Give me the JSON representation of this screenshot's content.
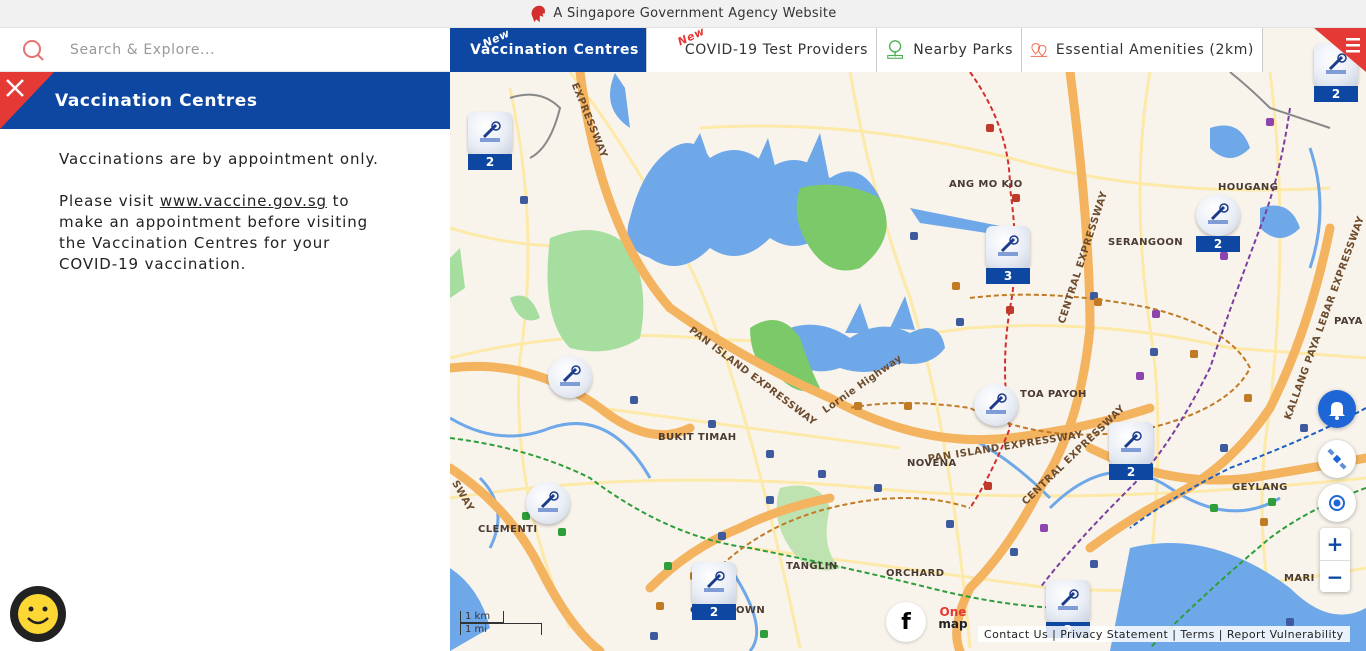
{
  "gov_bar": {
    "text": "A Singapore Government Agency Website"
  },
  "search": {
    "placeholder": "Search & Explore..."
  },
  "panel": {
    "title": "Vaccination Centres",
    "line1": "Vaccinations are by appointment only.",
    "para2_prefix": "Please visit ",
    "para2_link": "www.vaccine.gov.sg",
    "para2_suffix": " to make an appointment before visiting the Vaccination Centres for your COVID-19 vaccination."
  },
  "tabs": [
    {
      "label": "Vaccination Centres",
      "badge": "New",
      "active": true
    },
    {
      "label": "COVID-19 Test Providers",
      "badge": "New"
    },
    {
      "label": "Nearby Parks",
      "icon": "park-bench-icon"
    },
    {
      "label": "Essential Amenities (2km)",
      "icon": "map-pin-amenities-icon"
    }
  ],
  "places": [
    "ANG MO KIO",
    "HOUGANG",
    "SERANGOON",
    "PAYA",
    "TOA PAYOH",
    "BUKIT TIMAH",
    "NOVENA",
    "GEYLANG",
    "CLEMENTI",
    "TANGLIN",
    "ORCHARD",
    "MARI",
    "C",
    "OWN"
  ],
  "roads": [
    "EXPRESSWAY",
    "PAN ISLAND EXPRESSWAY",
    "Lornie Highway",
    "PAN ISLAND EXPRESSWAY",
    "CENTRAL EXPRESSWAY",
    "CENTRAL EXPRESSWAY",
    "KALLANG PAYA LEBAR EXPRESSWAY",
    "SWAY"
  ],
  "markers": [
    {
      "count": "2"
    },
    {
      "count": "2"
    },
    {
      "count": "3"
    },
    {
      "count": "2"
    },
    {
      "count": ""
    },
    {
      "count": ""
    },
    {
      "count": "2"
    },
    {
      "count": ""
    },
    {
      "count": "2"
    },
    {
      "count": "2"
    },
    {
      "count": ""
    }
  ],
  "scale": {
    "km": "1 km",
    "mi": "1 mi"
  },
  "zoom": {
    "in": "+",
    "out": "−"
  },
  "footer": {
    "contact": "Contact Us",
    "privacy": "Privacy Statement",
    "terms": "Terms",
    "report": "Report Vulnerability",
    "sep": "|"
  },
  "logos": {
    "facebook": "f",
    "onemap_top": "One",
    "onemap_bottom": "map"
  },
  "colors": {
    "brand_blue": "#0d47a1",
    "accent_red": "#e53935",
    "water": "#6fa8e8",
    "park": "#7cc96a",
    "expressway": "#f3b35f"
  }
}
